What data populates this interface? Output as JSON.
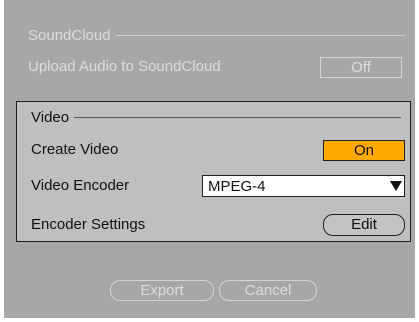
{
  "soundcloud": {
    "title": "SoundCloud",
    "upload_label": "Upload Audio to SoundCloud",
    "upload_toggle": "Off"
  },
  "video": {
    "title": "Video",
    "create_label": "Create Video",
    "create_toggle": "On",
    "encoder_label": "Video Encoder",
    "encoder_value": "MPEG-4",
    "settings_label": "Encoder Settings",
    "edit_button": "Edit"
  },
  "footer": {
    "export_button": "Export",
    "cancel_button": "Cancel"
  },
  "colors": {
    "on_active": "#ffa800",
    "panel_bg": "#bfbfbf",
    "window_bg": "#a7a7a7"
  }
}
